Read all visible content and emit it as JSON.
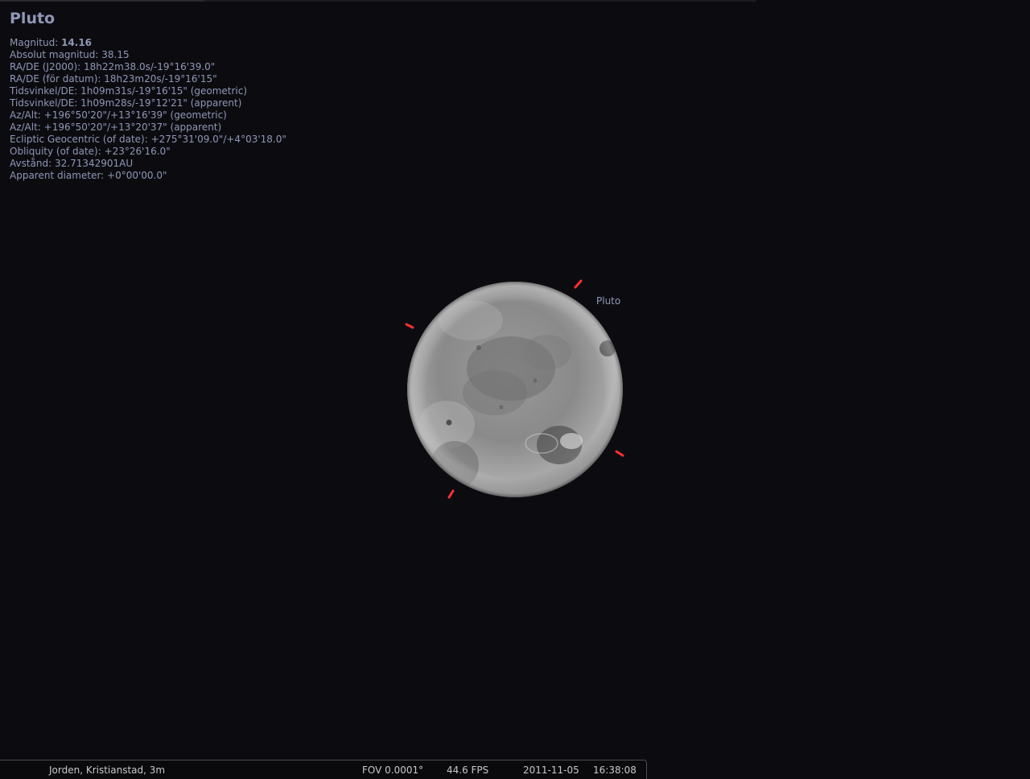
{
  "object": {
    "name": "Pluto",
    "label": "Pluto"
  },
  "info": {
    "magnitude_label": "Magnitud: ",
    "magnitude_value": "14.16",
    "lines": [
      "Absolut magnitud: 38.15",
      "RA/DE (J2000): 18h22m38.0s/-19°16'39.0\"",
      "RA/DE (för datum): 18h23m20s/-19°16'15\"",
      "Tidsvinkel/DE: 1h09m31s/-19°16'15\" (geometric)",
      "Tidsvinkel/DE: 1h09m28s/-19°12'21\" (apparent)",
      "Az/Alt: +196°50'20\"/+13°16'39\" (geometric)",
      "Az/Alt: +196°50'20\"/+13°20'37\" (apparent)",
      "Ecliptic Geocentric (of date): +275°31'09.0\"/+4°03'18.0\"",
      "Obliquity (of date): +23°26'16.0\"",
      "Avstånd: 32.71342901AU",
      "Apparent diameter: +0°00'00.0\""
    ]
  },
  "status_bar": {
    "location": "Jorden, Kristianstad, 3m",
    "fov": "FOV 0.0001°",
    "fps": "44.6 FPS",
    "date": "2011-11-05",
    "time": "16:38:08"
  },
  "colors": {
    "background": "#0c0c10",
    "info_text": "#8f97b6",
    "selection_marker": "#ff3030"
  },
  "icons": {
    "selection_marker": "selection-marker-icon"
  }
}
